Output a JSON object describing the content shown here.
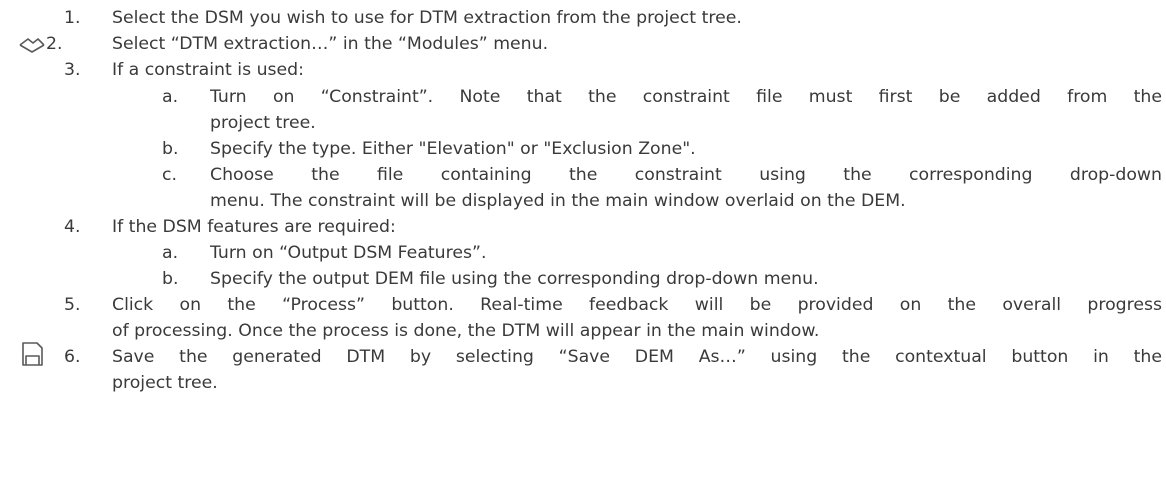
{
  "steps": [
    {
      "number": "1.",
      "text": "Select the DSM you wish to use for DTM extraction from the project tree."
    },
    {
      "number": "2.",
      "text": "Select “DTM extraction…” in the “Modules” menu.",
      "icon": "surface-icon"
    },
    {
      "number": "3.",
      "text": "If a constraint is used:",
      "substeps": [
        {
          "letter": "a.",
          "lines": [
            "Turn on “Constraint”. Note that the constraint file must first be added from the",
            "project tree."
          ]
        },
        {
          "letter": "b.",
          "lines": [
            "Specify the type. Either \"Elevation\" or \"Exclusion Zone\"."
          ]
        },
        {
          "letter": "c.",
          "lines": [
            "Choose the file containing the constraint using the corresponding drop-down",
            "menu. The constraint will be displayed in the main window overlaid on the DEM."
          ]
        }
      ]
    },
    {
      "number": "4.",
      "text": "If the DSM features are required:",
      "substeps": [
        {
          "letter": "a.",
          "lines": [
            "Turn on “Output DSM Features”."
          ]
        },
        {
          "letter": "b.",
          "lines": [
            "Specify the output DEM file using the corresponding drop-down menu."
          ]
        }
      ]
    },
    {
      "number": "5.",
      "lines": [
        "Click on the “Process” button.  Real-time feedback will be provided on the overall progress",
        "of processing.  Once the process is done, the DTM will appear in the main window."
      ]
    },
    {
      "number": "6.",
      "lines": [
        "Save the generated DTM by selecting “Save DEM As…” using the contextual button in the",
        "project tree."
      ],
      "icon": "save-icon"
    }
  ]
}
